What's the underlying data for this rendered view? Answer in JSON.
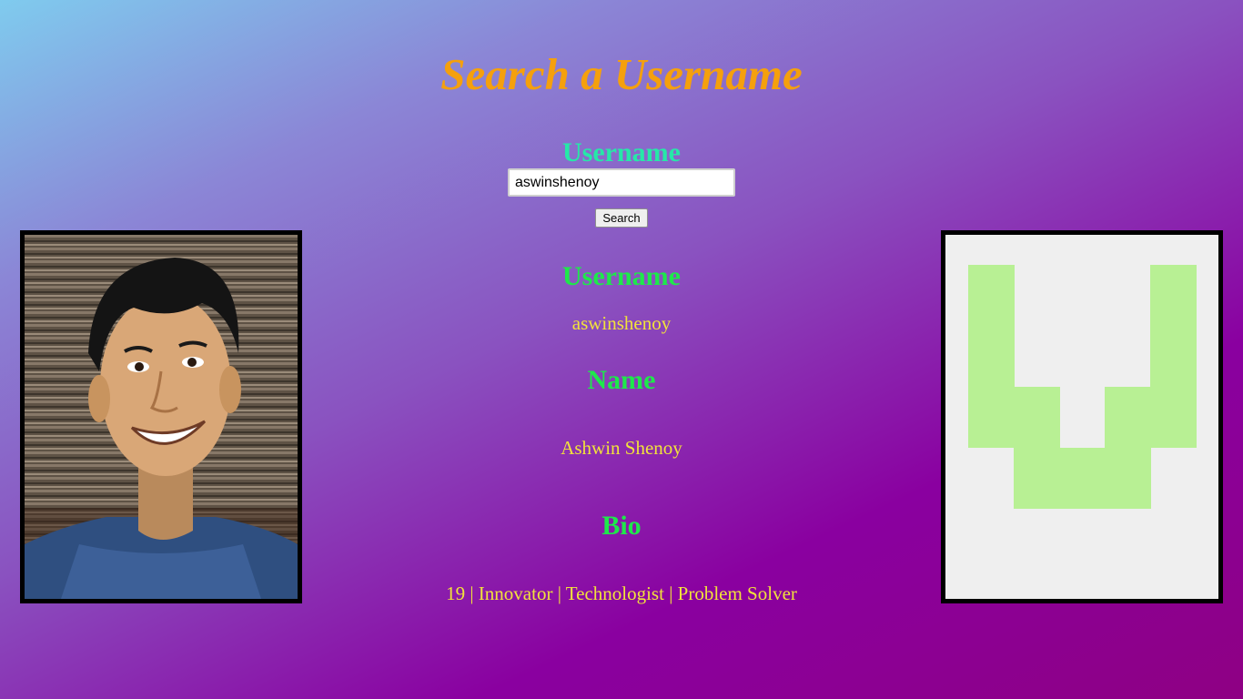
{
  "colors": {
    "title": "#f5a00d",
    "search_label": "#26e8a8",
    "section_heading": "#1ee84b",
    "section_value": "#f2e33a",
    "identicon_fill": "#b8f094",
    "identicon_background": "#efefef"
  },
  "header": {
    "title": "Search a Username"
  },
  "search": {
    "label": "Username",
    "input_value": "aswinshenoy",
    "button_label": "Search"
  },
  "profile": {
    "username_heading": "Username",
    "username_value": "aswinshenoy",
    "name_heading": "Name",
    "name_value": "Ashwin Shenoy",
    "bio_heading": "Bio",
    "bio_value": "19 | Innovator | Technologist | Problem Solver"
  },
  "avatar": {
    "icon": "user-photo-avatar"
  },
  "identicon": {
    "icon": "identicon-avatar",
    "grid": [
      [
        1,
        0,
        0,
        0,
        1
      ],
      [
        1,
        0,
        0,
        0,
        1
      ],
      [
        1,
        1,
        0,
        1,
        1
      ],
      [
        0,
        1,
        1,
        1,
        0
      ],
      [
        0,
        0,
        0,
        0,
        0
      ]
    ]
  }
}
